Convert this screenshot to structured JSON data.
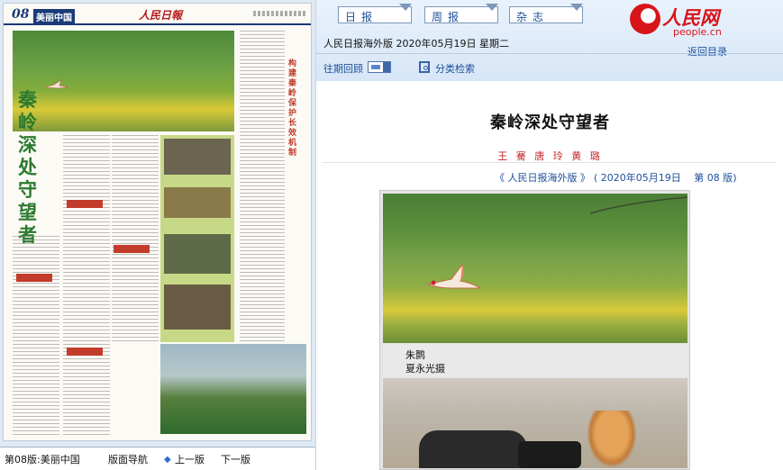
{
  "left_page": {
    "page_no": "08",
    "section": "美丽中国",
    "masthead": "人民日報",
    "title_vertical": "秦岭深处守望者",
    "side_title_vertical": "构建秦岭保护长效机制"
  },
  "left_nav": {
    "current_page": "第08版:美丽中国",
    "nav_label": "版面导航",
    "prev": "上一版",
    "next": "下一版"
  },
  "header": {
    "categories": [
      "日报",
      "周报",
      "杂志"
    ],
    "edition": "人民日报海外版",
    "date": "2020年05月19日",
    "weekday": "星期二",
    "past_issues": "往期回顾",
    "category_search": "分类检索",
    "back_to_index": "返回目录"
  },
  "logo": {
    "cn": "人民网",
    "en": "people.cn"
  },
  "article": {
    "title": "秦岭深处守望者",
    "authors": "王 騫 唐 玲 黄 璐",
    "source_paper": "《 人民日报海外版 》",
    "source_date": "( 2020年05月19日",
    "source_page": "第 08 版)",
    "photo_caption_title": "朱鹮",
    "photo_caption_credit": "夏永光摄"
  },
  "colors": {
    "brand_red": "#d7141a",
    "link_blue": "#1d4f9a",
    "panel_blue": "#d7e6f7"
  }
}
